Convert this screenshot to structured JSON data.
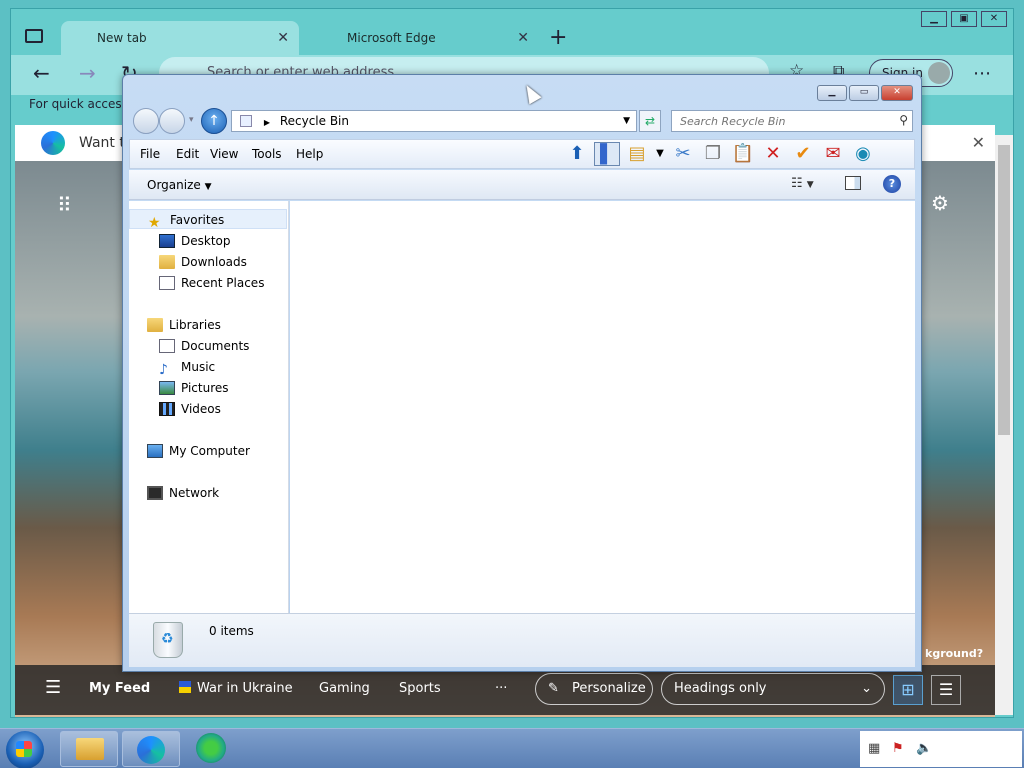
{
  "edge": {
    "tabs": [
      {
        "label": "New tab"
      },
      {
        "label": "Microsoft Edge"
      }
    ],
    "address_placeholder": "Search or enter web address",
    "sign_in": "Sign in",
    "quick_access": "For quick access,",
    "banner_text": "Want to",
    "bg_question": "kground?",
    "feed": {
      "my_feed": "My Feed",
      "war": "War in Ukraine",
      "gaming": "Gaming",
      "sports": "Sports",
      "more": "···",
      "personalize": "Personalize",
      "headings": "Headings only"
    }
  },
  "explorer": {
    "breadcrumb": "Recycle Bin",
    "search_placeholder": "Search Recycle Bin",
    "menu": [
      "File",
      "Edit",
      "View",
      "Tools",
      "Help"
    ],
    "organize": "Organize",
    "nav": {
      "favorites": "Favorites",
      "desktop": "Desktop",
      "downloads": "Downloads",
      "recent_places": "Recent Places",
      "libraries": "Libraries",
      "documents": "Documents",
      "music": "Music",
      "pictures": "Pictures",
      "videos": "Videos",
      "my_computer": "My Computer",
      "network": "Network"
    },
    "item_count": "0 items"
  },
  "colors": {
    "edge_accent": "#66cccc",
    "explorer_frame": "#c7dcf4",
    "close_button": "#c84030"
  },
  "icons": {
    "window_controls": [
      "minimize-icon",
      "maximize-icon",
      "close-icon"
    ],
    "toolbar": [
      "up-icon",
      "panel-icon",
      "folder-check-icon",
      "cut-icon",
      "copy-icon",
      "paste-icon",
      "delete-icon",
      "check-icon",
      "mail-icon",
      "globe-icon"
    ]
  }
}
